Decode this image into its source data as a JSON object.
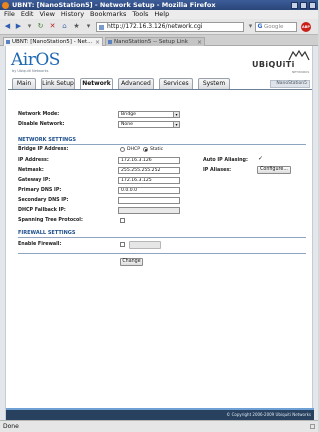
{
  "window": {
    "title": "UBNT: [NanoStation5] - Network Setup - Mozilla Firefox"
  },
  "menubar": {
    "items": [
      "File",
      "Edit",
      "View",
      "History",
      "Bookmarks",
      "Tools",
      "Help"
    ]
  },
  "toolbar": {
    "url": "http://172.16.3.126/network.cgi",
    "search_placeholder": "Google"
  },
  "tabs": [
    {
      "label": "UBNT: [NanoStation5] - Net..."
    },
    {
      "label": "NanoStation5 -- Setup Link"
    }
  ],
  "branding": {
    "product": "AirOS",
    "product_sub": "by Ubiquiti Networks",
    "vendor": "UBiQUiTi",
    "vendor_sub": "NETWORKS"
  },
  "nav": {
    "tabs": [
      "Main",
      "Link Setup",
      "Network",
      "Advanced",
      "Services",
      "System"
    ],
    "selected": "Network",
    "device_name": "NanoStation5"
  },
  "network": {
    "mode_label": "Network Mode:",
    "mode_value": "Bridge",
    "disable_label": "Disable Network:",
    "disable_value": "None"
  },
  "network_settings": {
    "title": "NETWORK SETTINGS",
    "bridge_ip_label": "Bridge IP Address:",
    "dhcp_label": "DHCP",
    "static_label": "Static",
    "ip_label": "IP Address:",
    "ip_value": "172.16.3.126",
    "netmask_label": "Netmask:",
    "netmask_value": "255.255.255.252",
    "gateway_label": "Gateway IP:",
    "gateway_value": "172.16.3.125",
    "dns1_label": "Primary DNS IP:",
    "dns1_value": "0.0.0.0",
    "dns2_label": "Secondary DNS IP:",
    "dns2_value": "",
    "fallback_label": "DHCP Fallback IP:",
    "fallback_value": "",
    "stp_label": "Spanning Tree Protocol:",
    "auto_alias_label": "Auto IP Aliasing:",
    "auto_alias_mark": "✓",
    "aliases_label": "IP Aliases:",
    "configure_label": "Configure..."
  },
  "firewall": {
    "title": "FIREWALL SETTINGS",
    "enable_label": "Enable Firewall:"
  },
  "actions": {
    "change_label": "Change"
  },
  "footer": {
    "copyright": "© Copyright 2006-2009 Ubiquiti Networks"
  },
  "status": {
    "text": "Done"
  },
  "colors": {
    "accent": "#1f69b4",
    "footer": "#27415f",
    "section": "#1d4f8c"
  }
}
